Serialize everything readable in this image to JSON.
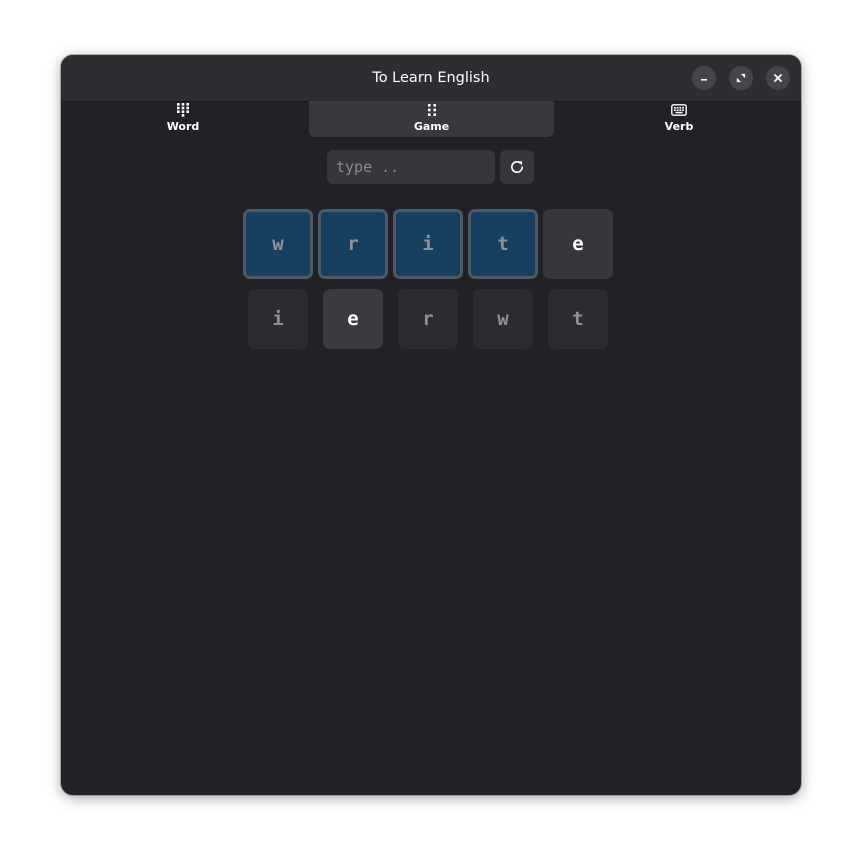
{
  "window": {
    "title": "To Learn English"
  },
  "header_buttons": {
    "minimize_icon": "minimize-icon",
    "maximize_icon": "maximize-icon",
    "close_icon": "close-icon"
  },
  "tabs": [
    {
      "label": "Word",
      "icon": "dialpad-icon",
      "selected": false
    },
    {
      "label": "Game",
      "icon": "grip-icon",
      "selected": true
    },
    {
      "label": "Verb",
      "icon": "keyboard-icon",
      "selected": false
    }
  ],
  "search": {
    "value": "",
    "placeholder": "type .."
  },
  "refresh": {
    "icon": "refresh-icon"
  },
  "answer_slots": [
    {
      "letter": "w",
      "state": "answered"
    },
    {
      "letter": "r",
      "state": "answered"
    },
    {
      "letter": "i",
      "state": "answered"
    },
    {
      "letter": "t",
      "state": "answered"
    },
    {
      "letter": "e",
      "state": "next"
    }
  ],
  "letter_pool": [
    {
      "letter": "i",
      "active": false
    },
    {
      "letter": "e",
      "active": true
    },
    {
      "letter": "r",
      "active": false
    },
    {
      "letter": "w",
      "active": false
    },
    {
      "letter": "t",
      "active": false
    }
  ],
  "colors": {
    "window_bg": "#222226",
    "headerbar_bg": "#2e2e32",
    "answered_tile_bg": "#173f5f",
    "answered_tile_border": "#4b5a63",
    "next_tile_bg": "#36363b"
  }
}
